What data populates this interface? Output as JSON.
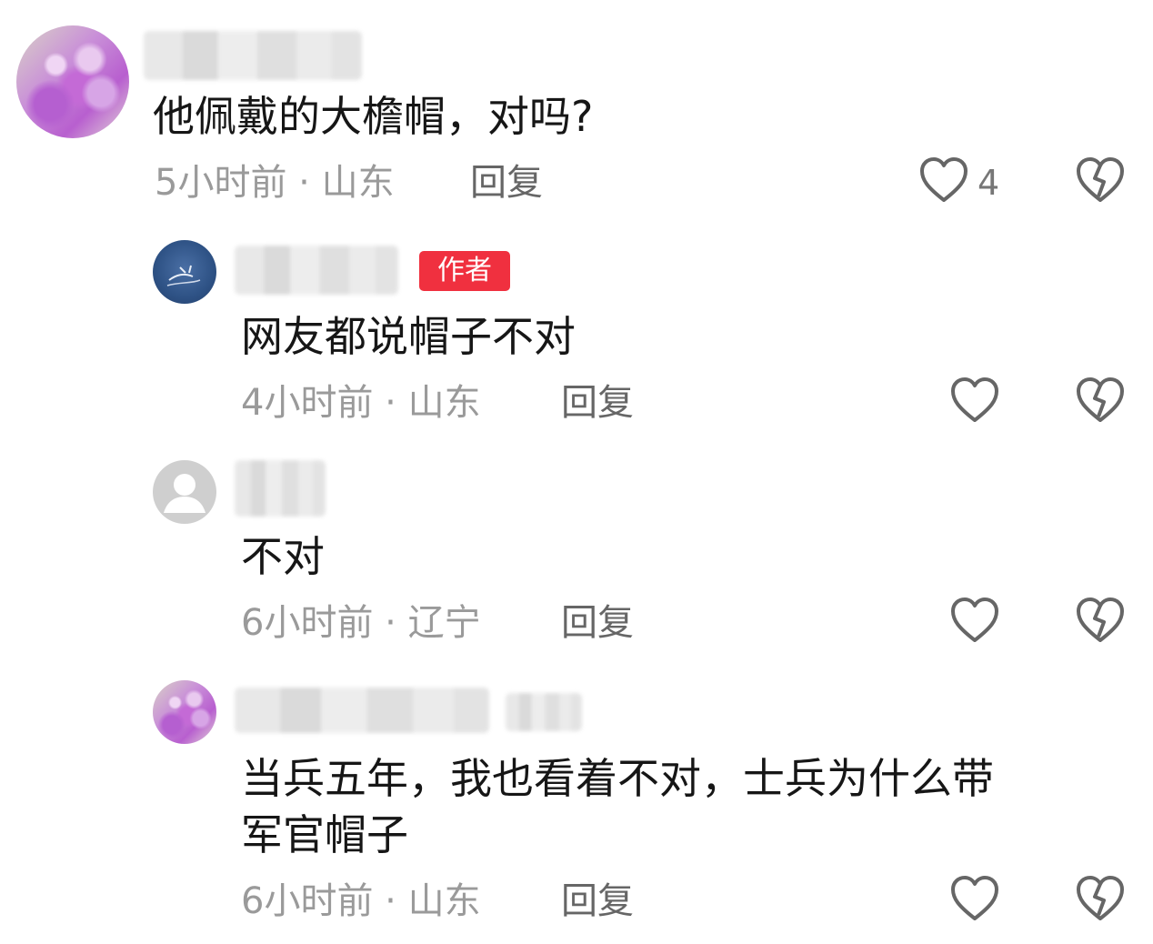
{
  "comments": [
    {
      "text": "他佩戴的大檐帽，对吗?",
      "meta": "5小时前 · 山东",
      "reply": "回复",
      "like_count": "4"
    },
    {
      "badge": "作者",
      "text": "网友都说帽子不对",
      "meta": "4小时前 · 山东",
      "reply": "回复"
    },
    {
      "text": "不对",
      "meta": "6小时前 · 辽宁",
      "reply": "回复"
    },
    {
      "text_line1": "当兵五年，我也看着不对，士兵为什么带",
      "text_line2": "军官帽子",
      "meta": "6小时前 · 山东",
      "reply": "回复"
    }
  ],
  "icons": {
    "like": "heart-icon",
    "dislike": "broken-heart-icon"
  },
  "colors": {
    "badge": "#f0303f",
    "meta": "#9a9a9a"
  }
}
